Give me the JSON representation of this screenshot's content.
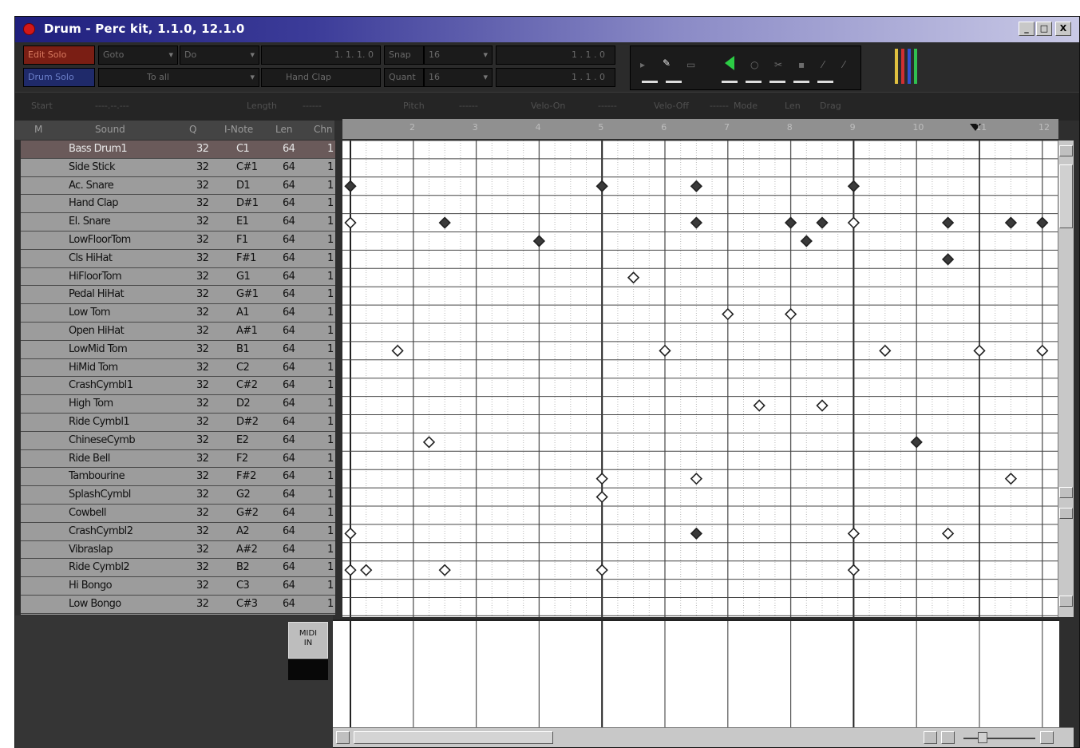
{
  "window": {
    "title": "Drum - Perc kit, 1.1.0, 12.1.0",
    "buttons": [
      "_",
      "□",
      "X"
    ]
  },
  "toolbar": {
    "edit_solo": "Edit Solo",
    "drum_solo": "Drum Solo",
    "goto_label": "Goto",
    "goto_arrow": "▾",
    "do_label": "Do",
    "do_arrow": "▾",
    "position_text": "1. 1. 1. 0",
    "to_label": "To all",
    "to_arrow": "▾",
    "instrument_text": "Hand Clap",
    "snap_label": "Snap",
    "snap_value": "16",
    "quant_label": "Quant",
    "quant_value": "16",
    "pos_readout": "1 . 1 . 0",
    "pos_readout_2": "1 . 1 . 0"
  },
  "info_bar": {
    "items": [
      "Start",
      "----.--.---",
      "Length",
      "------",
      "Pitch",
      "------",
      "Velo-On",
      "------",
      "Velo-Off",
      "------",
      "Mode",
      "Len",
      "Drag"
    ]
  },
  "table_headers": {
    "m": "M",
    "sound": "Sound",
    "q": "Q",
    "inote": "I-Note",
    "len": "Len",
    "chn": "Chn"
  },
  "drums": [
    {
      "name": "Bass Drum1",
      "q": "32",
      "note": "C1",
      "len": "64",
      "ch": "1"
    },
    {
      "name": "Side Stick",
      "q": "32",
      "note": "C#1",
      "len": "64",
      "ch": "1"
    },
    {
      "name": "Ac. Snare",
      "q": "32",
      "note": "D1",
      "len": "64",
      "ch": "1"
    },
    {
      "name": "Hand Clap",
      "q": "32",
      "note": "D#1",
      "len": "64",
      "ch": "1"
    },
    {
      "name": "El. Snare",
      "q": "32",
      "note": "E1",
      "len": "64",
      "ch": "1"
    },
    {
      "name": "LowFloorTom",
      "q": "32",
      "note": "F1",
      "len": "64",
      "ch": "1"
    },
    {
      "name": "Cls HiHat",
      "q": "32",
      "note": "F#1",
      "len": "64",
      "ch": "1"
    },
    {
      "name": "HiFloorTom",
      "q": "32",
      "note": "G1",
      "len": "64",
      "ch": "1"
    },
    {
      "name": "Pedal HiHat",
      "q": "32",
      "note": "G#1",
      "len": "64",
      "ch": "1"
    },
    {
      "name": "Low Tom",
      "q": "32",
      "note": "A1",
      "len": "64",
      "ch": "1"
    },
    {
      "name": "Open HiHat",
      "q": "32",
      "note": "A#1",
      "len": "64",
      "ch": "1"
    },
    {
      "name": "LowMid Tom",
      "q": "32",
      "note": "B1",
      "len": "64",
      "ch": "1"
    },
    {
      "name": "HiMid Tom",
      "q": "32",
      "note": "C2",
      "len": "64",
      "ch": "1"
    },
    {
      "name": "CrashCymbl1",
      "q": "32",
      "note": "C#2",
      "len": "64",
      "ch": "1"
    },
    {
      "name": "High Tom",
      "q": "32",
      "note": "D2",
      "len": "64",
      "ch": "1"
    },
    {
      "name": "Ride Cymbl1",
      "q": "32",
      "note": "D#2",
      "len": "64",
      "ch": "1"
    },
    {
      "name": "ChineseCymb",
      "q": "32",
      "note": "E2",
      "len": "64",
      "ch": "1"
    },
    {
      "name": "Ride Bell",
      "q": "32",
      "note": "F2",
      "len": "64",
      "ch": "1"
    },
    {
      "name": "Tambourine",
      "q": "32",
      "note": "F#2",
      "len": "64",
      "ch": "1"
    },
    {
      "name": "SplashCymbl",
      "q": "32",
      "note": "G2",
      "len": "64",
      "ch": "1"
    },
    {
      "name": "Cowbell",
      "q": "32",
      "note": "G#2",
      "len": "64",
      "ch": "1"
    },
    {
      "name": "CrashCymbl2",
      "q": "32",
      "note": "A2",
      "len": "64",
      "ch": "1"
    },
    {
      "name": "Vibraslap",
      "q": "32",
      "note": "A#2",
      "len": "64",
      "ch": "1"
    },
    {
      "name": "Ride Cymbl2",
      "q": "32",
      "note": "B2",
      "len": "64",
      "ch": "1"
    },
    {
      "name": "Hi Bongo",
      "q": "32",
      "note": "C3",
      "len": "64",
      "ch": "1"
    },
    {
      "name": "Low Bongo",
      "q": "32",
      "note": "C#3",
      "len": "64",
      "ch": "1"
    }
  ],
  "selected_row": 0,
  "ruler_marks": [
    "2",
    "3",
    "4",
    "5",
    "6",
    "7",
    "8",
    "9",
    "10",
    "11",
    "12"
  ],
  "notes": [
    {
      "row": 2,
      "step": 0,
      "filled": true
    },
    {
      "row": 2,
      "step": 16,
      "filled": true
    },
    {
      "row": 2,
      "step": 22,
      "filled": true
    },
    {
      "row": 2,
      "step": 32,
      "filled": true
    },
    {
      "row": 4,
      "step": 0,
      "filled": false
    },
    {
      "row": 4,
      "step": 6,
      "filled": true
    },
    {
      "row": 4,
      "step": 22,
      "filled": true
    },
    {
      "row": 4,
      "step": 28,
      "filled": true
    },
    {
      "row": 4,
      "step": 30,
      "filled": true
    },
    {
      "row": 4,
      "step": 32,
      "filled": false
    },
    {
      "row": 4,
      "step": 38,
      "filled": true
    },
    {
      "row": 4,
      "step": 42,
      "filled": true
    },
    {
      "row": 4,
      "step": 44,
      "filled": true
    },
    {
      "row": 5,
      "step": 12,
      "filled": true
    },
    {
      "row": 5,
      "step": 29,
      "filled": true
    },
    {
      "row": 6,
      "step": 38,
      "filled": true
    },
    {
      "row": 7,
      "step": 18,
      "filled": false
    },
    {
      "row": 9,
      "step": 24,
      "filled": false
    },
    {
      "row": 9,
      "step": 28,
      "filled": false
    },
    {
      "row": 11,
      "step": 3,
      "filled": false
    },
    {
      "row": 11,
      "step": 20,
      "filled": false
    },
    {
      "row": 11,
      "step": 34,
      "filled": false
    },
    {
      "row": 11,
      "step": 40,
      "filled": false
    },
    {
      "row": 11,
      "step": 44,
      "filled": false
    },
    {
      "row": 14,
      "step": 26,
      "filled": false
    },
    {
      "row": 14,
      "step": 30,
      "filled": false
    },
    {
      "row": 16,
      "step": 5,
      "filled": false
    },
    {
      "row": 16,
      "step": 36,
      "filled": true
    },
    {
      "row": 18,
      "step": 16,
      "filled": false
    },
    {
      "row": 18,
      "step": 22,
      "filled": false
    },
    {
      "row": 18,
      "step": 42,
      "filled": false
    },
    {
      "row": 19,
      "step": 16,
      "filled": false
    },
    {
      "row": 21,
      "step": 0,
      "filled": false
    },
    {
      "row": 21,
      "step": 22,
      "filled": true
    },
    {
      "row": 21,
      "step": 32,
      "filled": false
    },
    {
      "row": 21,
      "step": 38,
      "filled": false
    },
    {
      "row": 23,
      "step": 0,
      "filled": false
    },
    {
      "row": 23,
      "step": 1,
      "filled": false
    },
    {
      "row": 23,
      "step": 6,
      "filled": false
    },
    {
      "row": 23,
      "step": 16,
      "filled": false
    },
    {
      "row": 23,
      "step": 32,
      "filled": false
    }
  ],
  "mini_button": "MIDI\nIN",
  "colors": {
    "selected_row": "#6a5a5a",
    "edit_solo": "#7a1e14",
    "drum_solo": "#1f2a6a",
    "speaker": "#2ccd45",
    "meter": [
      "#e0c040",
      "#d03030",
      "#3050d0",
      "#30c050"
    ]
  }
}
